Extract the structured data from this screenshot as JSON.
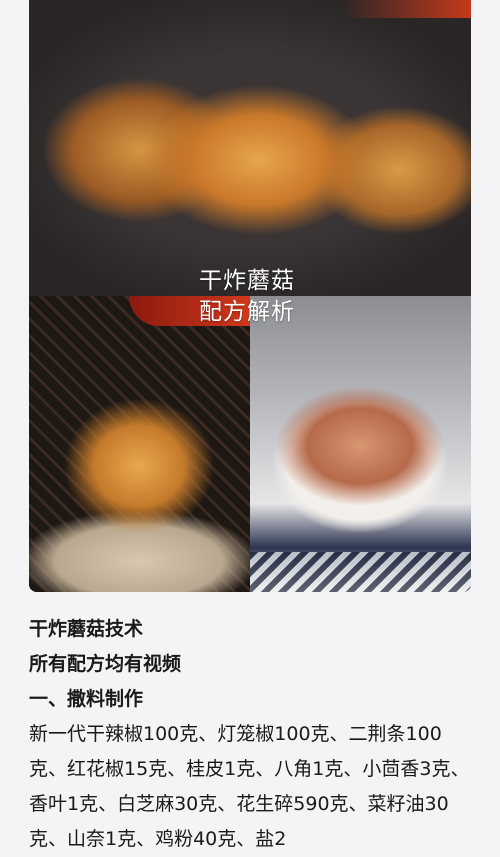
{
  "hero": {
    "overlay_line1": "干炸蘑菇",
    "overlay_line2": "配方解析"
  },
  "article": {
    "title": "干炸蘑菇技术",
    "subtitle": "所有配方均有视频",
    "section1_heading": "一、撒料制作",
    "section1_body": "新一代干辣椒100克、灯笼椒100克、二荆条100克、红花椒15克、桂皮1克、八角1克、小茴香3克、香叶1克、白芝麻30克、花生碎590克、菜籽油30克、山奈1克、鸡粉40克、盐2"
  }
}
